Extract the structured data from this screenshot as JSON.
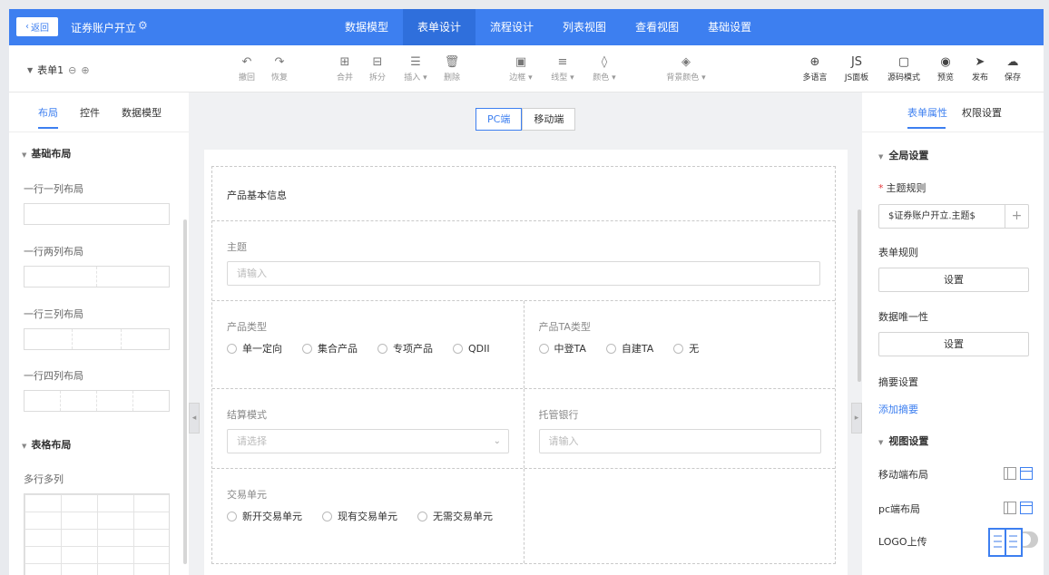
{
  "topbar": {
    "back_label": "返回",
    "title": "证券账户开立",
    "nav_tabs": [
      "数据模型",
      "表单设计",
      "流程设计",
      "列表视图",
      "查看视图",
      "基础设置"
    ],
    "active_tab": "表单设计",
    "accent_color": "#3d7ff0"
  },
  "toolbar": {
    "form_name": "表单1",
    "undo": "撤回",
    "redo": "恢复",
    "merge": "合并",
    "split": "拆分",
    "insert": "插入",
    "delete": "删除",
    "border": "边框",
    "line_type": "线型",
    "color": "颜色",
    "bg_color": "背景颜色",
    "multi_lang": "多语言",
    "js_panel": "JS面板",
    "source_mode": "源码模式",
    "preview": "预览",
    "publish": "发布",
    "save": "保存"
  },
  "left_panel": {
    "tabs": [
      "布局",
      "控件",
      "数据模型"
    ],
    "active_tab": "布局",
    "section_basic": "基础布局",
    "layouts": [
      "一行一列布局",
      "一行两列布局",
      "一行三列布局",
      "一行四列布局"
    ],
    "section_table": "表格布局",
    "table_item": "多行多列"
  },
  "center": {
    "view_pc": "PC端",
    "view_mobile": "移动端",
    "active_view": "PC端",
    "form": {
      "header": "产品基本信息",
      "subject_label": "主题",
      "subject_placeholder": "请输入",
      "product_type_label": "产品类型",
      "product_type_options": [
        "单一定向",
        "集合产品",
        "专项产品",
        "QDII"
      ],
      "ta_type_label": "产品TA类型",
      "ta_type_options": [
        "中登TA",
        "自建TA",
        "无"
      ],
      "settlement_label": "结算模式",
      "settlement_placeholder": "请选择",
      "custodian_label": "托管银行",
      "custodian_placeholder": "请输入",
      "trade_unit_label": "交易单元",
      "trade_unit_options": [
        "新开交易单元",
        "现有交易单元",
        "无需交易单元"
      ]
    }
  },
  "right_panel": {
    "tabs": [
      "表单属性",
      "权限设置"
    ],
    "active_tab": "表单属性",
    "global_section": "全局设置",
    "theme_rule_label": "主题规则",
    "theme_rule_value": "$证券账户开立.主题$",
    "form_rule_label": "表单规则",
    "form_rule_button": "设置",
    "data_unique_label": "数据唯一性",
    "data_unique_button": "设置",
    "summary_label": "摘要设置",
    "summary_link": "添加摘要",
    "view_section": "视图设置",
    "mobile_layout_label": "移动端布局",
    "pc_layout_label": "pc端布局",
    "logo_label": "LOGO上传"
  }
}
